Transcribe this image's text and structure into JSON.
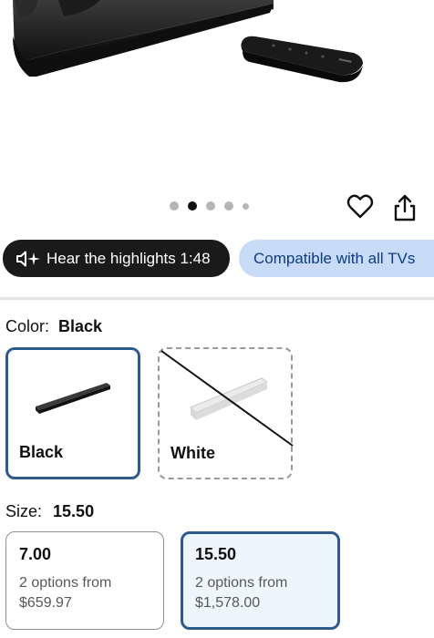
{
  "gallery": {
    "dots": [
      {
        "active": false
      },
      {
        "active": true
      },
      {
        "active": false
      },
      {
        "active": false
      },
      {
        "active": false
      }
    ],
    "icons": {
      "favorite": "heart-icon",
      "share": "share-icon"
    }
  },
  "chips": {
    "audio_label": "Hear the highlights 1:48",
    "compat_label": "Compatible with all TVs"
  },
  "color": {
    "label": "Color:",
    "selected": "Black",
    "options": [
      {
        "name": "Black",
        "selected": true,
        "available": true
      },
      {
        "name": "White",
        "selected": false,
        "available": false
      }
    ]
  },
  "size": {
    "label": "Size:",
    "selected": "15.50",
    "options": [
      {
        "size": "7.00",
        "options_text": "2 options from",
        "price": "$659.97",
        "selected": false
      },
      {
        "size": "15.50",
        "options_text": "2 options from",
        "price": "$1,578.00",
        "selected": true
      }
    ]
  },
  "colors": {
    "selected_border": "#2f5a8e",
    "compat_chip_bg": "#c8dcf8",
    "audio_chip_bg": "#1a1a1a"
  }
}
